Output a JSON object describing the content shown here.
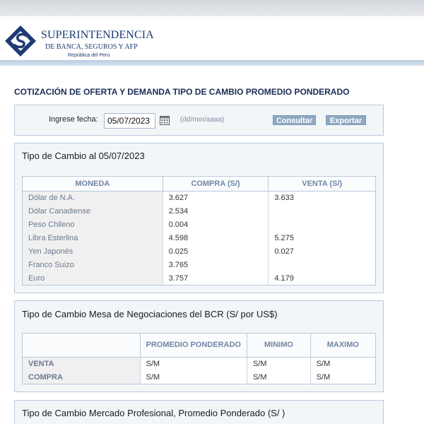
{
  "brand": {
    "line1": "SUPERINTENDENCIA",
    "line2": "DE BANCA, SEGUROS Y AFP",
    "line3": "República del Perú"
  },
  "page": {
    "title": "COTIZACIÓN DE OFERTA Y DEMANDA TIPO DE CAMBIO PROMEDIO PONDERADO"
  },
  "search": {
    "label": "Ingrese fecha:",
    "date_value": "05/07/2023",
    "format_hint": "(dd/mm/aaaa)",
    "consultar_label": "Consultar",
    "exportar_label": "Exportar"
  },
  "tipo_cambio": {
    "title": "Tipo de Cambio al 05/07/2023",
    "headers": [
      "MONEDA",
      "COMPRA (S/)",
      "VENTA (S/)"
    ],
    "rows": [
      {
        "moneda": "Dólar de N.A.",
        "compra": "3.627",
        "venta": "3.633"
      },
      {
        "moneda": "Dólar Canadiense",
        "compra": "2.534",
        "venta": ""
      },
      {
        "moneda": "Peso Chileno",
        "compra": "0.004",
        "venta": ""
      },
      {
        "moneda": "Libra Esterlina",
        "compra": "4.598",
        "venta": "5.275"
      },
      {
        "moneda": "Yen Japonés",
        "compra": "0.025",
        "venta": "0.027"
      },
      {
        "moneda": "Franco Suizo",
        "compra": "3.765",
        "venta": ""
      },
      {
        "moneda": "Euro",
        "compra": "3.757",
        "venta": "4.179"
      }
    ]
  },
  "bcr": {
    "title": "Tipo de Cambio Mesa de Negociaciones del BCR (S/ por US$)",
    "headers": [
      "",
      "PROMEDIO PONDERADO",
      "MINIMO",
      "MAXIMO"
    ],
    "rows": [
      {
        "label": "VENTA",
        "promedio": "S/M",
        "minimo": "S/M",
        "maximo": "S/M"
      },
      {
        "label": "COMPRA",
        "promedio": "S/M",
        "minimo": "S/M",
        "maximo": "S/M"
      }
    ]
  },
  "profesional": {
    "title": "Tipo de Cambio Mercado Profesional, Promedio Ponderado (S/ )"
  },
  "icons": {
    "logo": "sbs-logo-icon",
    "calendar": "calendar-icon"
  },
  "colors": {
    "brand_blue": "#1d3a73",
    "header_text": "#6f86a6",
    "button_bg": "#8ea8c3",
    "panel_border": "#b8c9dc"
  }
}
